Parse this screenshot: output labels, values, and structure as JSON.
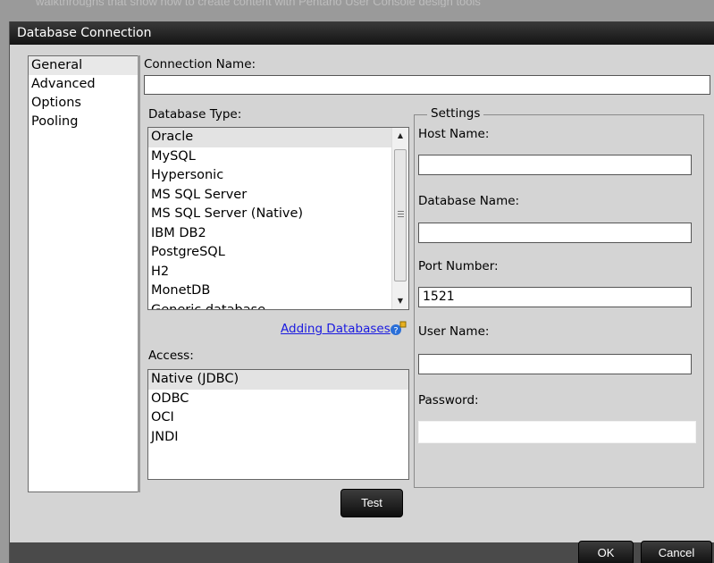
{
  "backdrop": {
    "text": "walkthroughs that show how to create content with Pentaho User Console design tools"
  },
  "window": {
    "title": "Database Connection"
  },
  "nav": {
    "items": [
      {
        "label": "General",
        "selected": true
      },
      {
        "label": "Advanced",
        "selected": false
      },
      {
        "label": "Options",
        "selected": false
      },
      {
        "label": "Pooling",
        "selected": false
      }
    ]
  },
  "connection": {
    "label": "Connection Name:",
    "value": ""
  },
  "db_type": {
    "label": "Database Type:",
    "items": [
      "Oracle",
      "MySQL",
      "Hypersonic",
      "MS SQL Server",
      "MS SQL Server (Native)",
      "IBM DB2",
      "PostgreSQL",
      "H2",
      "MonetDB",
      "Generic database"
    ],
    "selected": "Oracle",
    "scroll_up": "▲",
    "scroll_down": "▼"
  },
  "adding_link": {
    "label": "Adding Databases"
  },
  "access": {
    "label": "Access:",
    "items": [
      "Native (JDBC)",
      "ODBC",
      "OCI",
      "JNDI"
    ],
    "selected": "Native (JDBC)"
  },
  "settings": {
    "legend": "Settings",
    "host_label": "Host Name:",
    "host_value": "",
    "dbname_label": "Database Name:",
    "dbname_value": "",
    "port_label": "Port Number:",
    "port_value": "1521",
    "user_label": "User Name:",
    "user_value": "",
    "password_label": "Password:",
    "password_value": ""
  },
  "buttons": {
    "test": "Test",
    "ok": "OK",
    "cancel": "Cancel"
  },
  "colors": {
    "title_bar": "#1e1e1e",
    "dialog_bg": "#d4d4d4",
    "link": "#1a1ae0",
    "button": "#1a1a1a"
  }
}
